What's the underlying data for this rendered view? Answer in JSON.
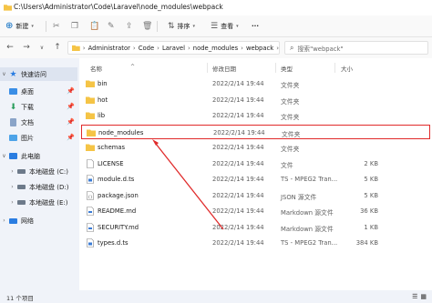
{
  "window": {
    "title": "C:\\Users\\Administrator\\Code\\Laravel\\node_modules\\webpack"
  },
  "toolbar": {
    "new_label": "新建",
    "sort_label": "排序",
    "view_label": "查看",
    "more_label": "···"
  },
  "address": {
    "crumbs": [
      "Administrator",
      "Code",
      "Laravel",
      "node_modules",
      "webpack"
    ],
    "search_placeholder": "搜索\"webpack\""
  },
  "sidebar": {
    "items": [
      {
        "label": "快速访问",
        "icon": "star-icon"
      },
      {
        "label": "桌面",
        "icon": "desktop-icon"
      },
      {
        "label": "下载",
        "icon": "download-icon"
      },
      {
        "label": "文档",
        "icon": "document-icon"
      },
      {
        "label": "图片",
        "icon": "picture-icon"
      },
      {
        "label": "此电脑",
        "icon": "pc-icon"
      },
      {
        "label": "本地磁盘 (C:)",
        "icon": "drive-icon"
      },
      {
        "label": "本地磁盘 (D:)",
        "icon": "drive-icon"
      },
      {
        "label": "本地磁盘 (E:)",
        "icon": "drive-icon"
      },
      {
        "label": "网络",
        "icon": "network-icon"
      }
    ]
  },
  "columns": {
    "name": "名称",
    "date": "修改日期",
    "type": "类型",
    "size": "大小"
  },
  "files": [
    {
      "name": "bin",
      "date": "2022/2/14 19:44",
      "type": "文件夹",
      "size": "",
      "icon": "folder-icon"
    },
    {
      "name": "hot",
      "date": "2022/2/14 19:44",
      "type": "文件夹",
      "size": "",
      "icon": "folder-icon"
    },
    {
      "name": "lib",
      "date": "2022/2/14 19:44",
      "type": "文件夹",
      "size": "",
      "icon": "folder-icon"
    },
    {
      "name": "node_modules",
      "date": "2022/2/14 19:44",
      "type": "文件夹",
      "size": "",
      "icon": "folder-icon"
    },
    {
      "name": "schemas",
      "date": "2022/2/14 19:44",
      "type": "文件夹",
      "size": "",
      "icon": "folder-icon"
    },
    {
      "name": "LICENSE",
      "date": "2022/2/14 19:44",
      "type": "文件",
      "size": "2 KB",
      "icon": "file-icon"
    },
    {
      "name": "module.d.ts",
      "date": "2022/2/14 19:44",
      "type": "TS - MPEG2 Tran...",
      "size": "5 KB",
      "icon": "video-file-icon"
    },
    {
      "name": "package.json",
      "date": "2022/2/14 19:44",
      "type": "JSON 源文件",
      "size": "5 KB",
      "icon": "json-file-icon"
    },
    {
      "name": "README.md",
      "date": "2022/2/14 19:44",
      "type": "Markdown 源文件",
      "size": "36 KB",
      "icon": "markdown-file-icon"
    },
    {
      "name": "SECURITY.md",
      "date": "2022/2/14 19:44",
      "type": "Markdown 源文件",
      "size": "1 KB",
      "icon": "markdown-file-icon"
    },
    {
      "name": "types.d.ts",
      "date": "2022/2/14 19:44",
      "type": "TS - MPEG2 Tran...",
      "size": "384 KB",
      "icon": "video-file-icon"
    }
  ],
  "status": {
    "count": "11 个项目"
  },
  "colors": {
    "folder": "#f5c446",
    "highlight": "#e02a2a",
    "arrow": "#e02a2a",
    "accent": "#0067c0"
  }
}
